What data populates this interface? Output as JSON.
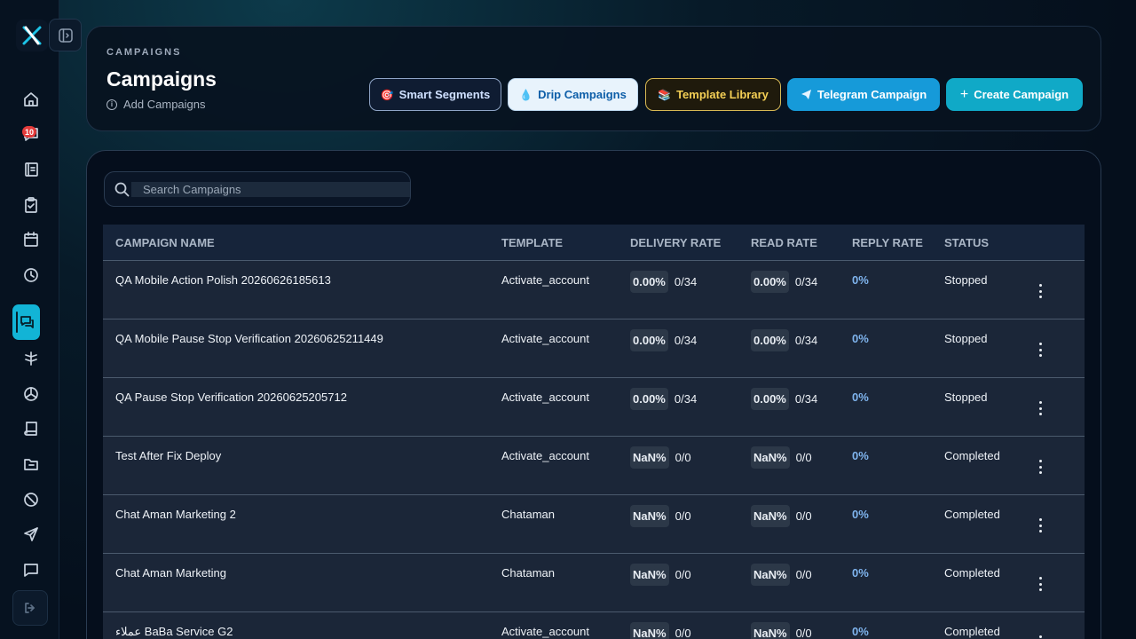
{
  "header": {
    "eyebrow": "CAMPAIGNS",
    "title": "Campaigns",
    "subtitle": "Add Campaigns",
    "buttons": {
      "smart_segments": "Smart Segments",
      "drip_campaigns": "Drip Campaigns",
      "template_library": "Template Library",
      "telegram_campaign": "Telegram Campaign",
      "create_campaign": "Create Campaign"
    }
  },
  "sidebar": {
    "notification_count": "10"
  },
  "search": {
    "placeholder": "Search Campaigns",
    "value": ""
  },
  "table": {
    "columns": {
      "name": "CAMPAIGN NAME",
      "template": "TEMPLATE",
      "delivery": "DELIVERY RATE",
      "read": "READ RATE",
      "reply": "REPLY RATE",
      "status": "STATUS"
    },
    "rows": [
      {
        "name": "QA Mobile Action Polish 20260626185613",
        "template": "Activate_account",
        "delivery_pct": "0.00%",
        "delivery_count": "0/34",
        "read_pct": "0.00%",
        "read_count": "0/34",
        "reply": "0%",
        "status": "Stopped"
      },
      {
        "name": "QA Mobile Pause Stop Verification 20260625211449",
        "template": "Activate_account",
        "delivery_pct": "0.00%",
        "delivery_count": "0/34",
        "read_pct": "0.00%",
        "read_count": "0/34",
        "reply": "0%",
        "status": "Stopped"
      },
      {
        "name": "QA Pause Stop Verification 20260625205712",
        "template": "Activate_account",
        "delivery_pct": "0.00%",
        "delivery_count": "0/34",
        "read_pct": "0.00%",
        "read_count": "0/34",
        "reply": "0%",
        "status": "Stopped"
      },
      {
        "name": "Test After Fix Deploy",
        "template": "Activate_account",
        "delivery_pct": "NaN%",
        "delivery_count": "0/0",
        "read_pct": "NaN%",
        "read_count": "0/0",
        "reply": "0%",
        "status": "Completed"
      },
      {
        "name": "Chat Aman Marketing 2",
        "template": "Chataman",
        "delivery_pct": "NaN%",
        "delivery_count": "0/0",
        "read_pct": "NaN%",
        "read_count": "0/0",
        "reply": "0%",
        "status": "Completed"
      },
      {
        "name": "Chat Aman Marketing",
        "template": "Chataman",
        "delivery_pct": "NaN%",
        "delivery_count": "0/0",
        "read_pct": "NaN%",
        "read_count": "0/0",
        "reply": "0%",
        "status": "Completed"
      },
      {
        "name": "عملاء BaBa Service G2",
        "template": "Activate_account",
        "delivery_pct": "NaN%",
        "delivery_count": "0/0",
        "read_pct": "NaN%",
        "read_count": "0/0",
        "reply": "0%",
        "status": "Completed"
      }
    ]
  }
}
